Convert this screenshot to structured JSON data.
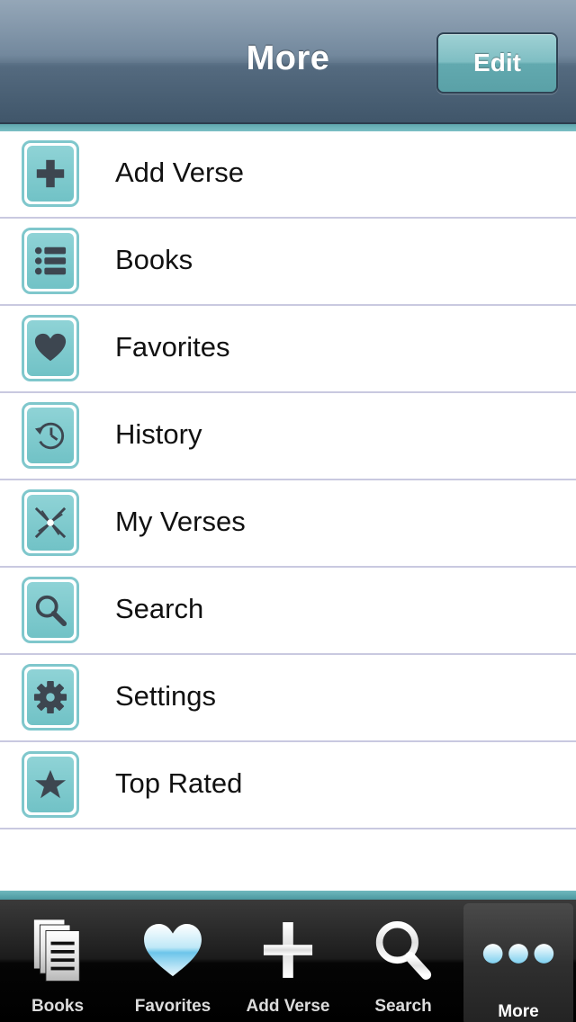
{
  "navbar": {
    "title": "More",
    "edit_label": "Edit"
  },
  "list": {
    "items": [
      {
        "label": "Add Verse",
        "icon": "plus-icon"
      },
      {
        "label": "Books",
        "icon": "list-icon"
      },
      {
        "label": "Favorites",
        "icon": "heart-icon"
      },
      {
        "label": "History",
        "icon": "clock-history-icon"
      },
      {
        "label": "My Verses",
        "icon": "sparkle-icon"
      },
      {
        "label": "Search",
        "icon": "magnifier-icon"
      },
      {
        "label": "Settings",
        "icon": "gear-icon"
      },
      {
        "label": "Top Rated",
        "icon": "star-icon"
      }
    ]
  },
  "tabbar": {
    "tabs": [
      {
        "label": "Books",
        "icon": "books-icon"
      },
      {
        "label": "Favorites",
        "icon": "heart-icon"
      },
      {
        "label": "Add Verse",
        "icon": "plus-icon"
      },
      {
        "label": "Search",
        "icon": "magnifier-icon"
      },
      {
        "label": "More",
        "icon": "more-dots-icon",
        "selected": true
      }
    ]
  },
  "colors": {
    "accent_teal": "#7fc7cc",
    "icon_glyph": "#3d4650"
  }
}
